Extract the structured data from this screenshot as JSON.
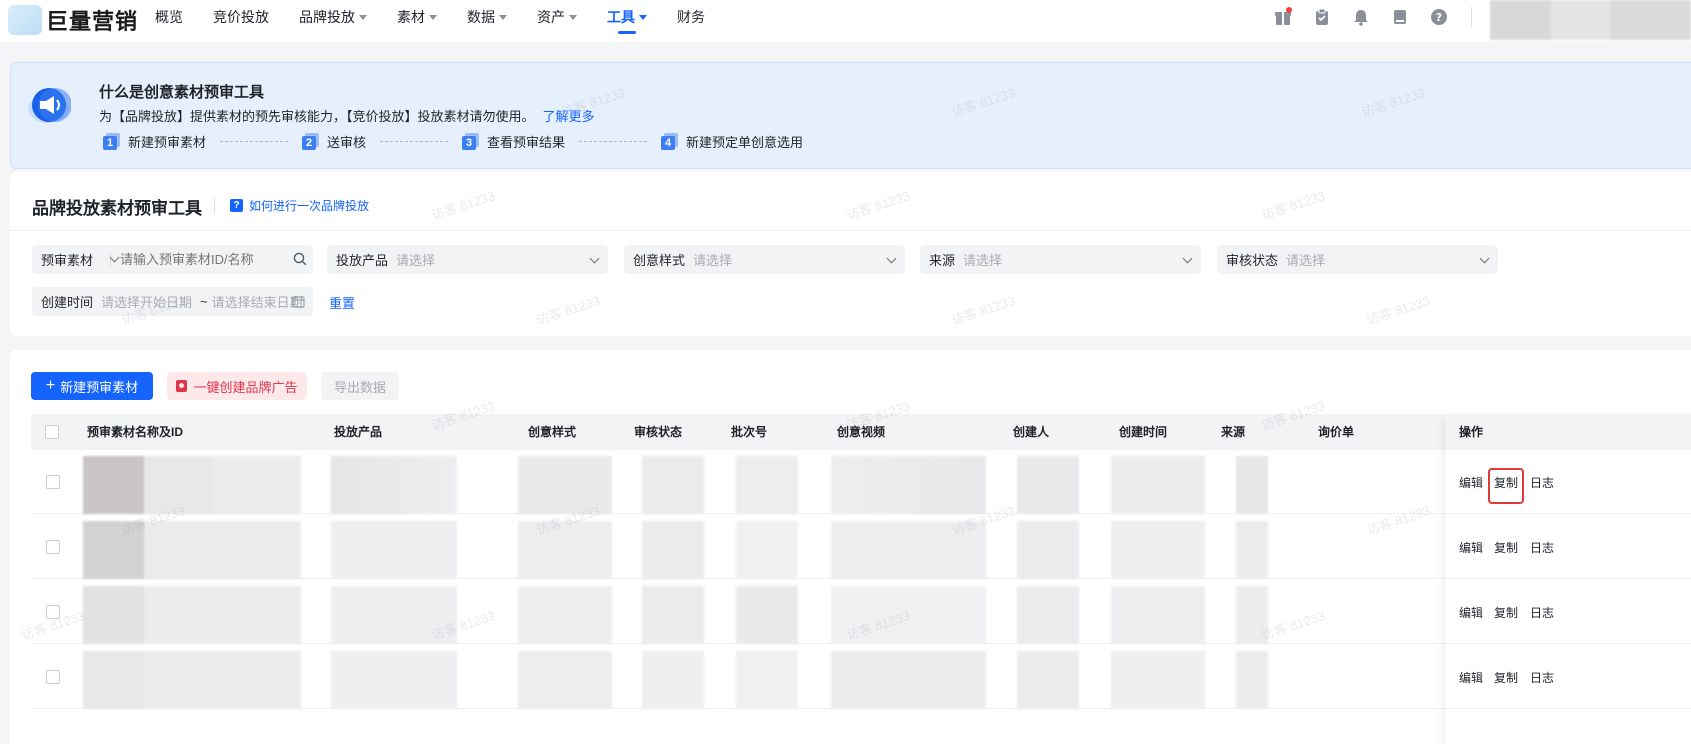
{
  "brand": {
    "name": "巨量营销"
  },
  "nav": {
    "items": [
      {
        "label": "概览",
        "dropdown": false,
        "active": false
      },
      {
        "label": "竞价投放",
        "dropdown": false,
        "active": false
      },
      {
        "label": "品牌投放",
        "dropdown": true,
        "active": false
      },
      {
        "label": "素材",
        "dropdown": true,
        "active": false
      },
      {
        "label": "数据",
        "dropdown": true,
        "active": false
      },
      {
        "label": "资产",
        "dropdown": true,
        "active": false
      },
      {
        "label": "工具",
        "dropdown": true,
        "active": true
      },
      {
        "label": "财务",
        "dropdown": false,
        "active": false
      }
    ],
    "icons": [
      "gift-icon",
      "clipboard-icon",
      "bell-icon",
      "document-icon",
      "help-icon"
    ],
    "accent": "#1664ff"
  },
  "banner": {
    "title": "什么是创意素材预审工具",
    "desc": "为【品牌投放】提供素材的预先审核能力，【竞价投放】投放素材请勿使用。",
    "link": "了解更多",
    "steps": [
      {
        "num": "1",
        "label": "新建预审素材"
      },
      {
        "num": "2",
        "label": "送审核"
      },
      {
        "num": "3",
        "label": "查看预审结果"
      },
      {
        "num": "4",
        "label": "新建预定单创意选用"
      }
    ]
  },
  "tool": {
    "title": "品牌投放素材预审工具",
    "help_link": "如何进行一次品牌投放",
    "filters": {
      "material_type": "预审素材",
      "search_placeholder": "请输入预审素材ID/名称",
      "product_label": "投放产品",
      "product_placeholder": "请选择",
      "style_label": "创意样式",
      "style_placeholder": "请选择",
      "source_label": "来源",
      "source_placeholder": "请选择",
      "status_label": "审核状态",
      "status_placeholder": "请选择",
      "created_label": "创建时间",
      "start_placeholder": "请选择开始日期",
      "range_sep": "~",
      "end_placeholder": "请选择结束日期",
      "reset": "重置"
    }
  },
  "actions": {
    "new_material": "新建预审素材",
    "create_brand_ad": "一键创建品牌广告",
    "export": "导出数据"
  },
  "table": {
    "columns": [
      "预审素材名称及ID",
      "投放产品",
      "创意样式",
      "审核状态",
      "批次号",
      "创意视频",
      "创建人",
      "创建时间",
      "来源",
      "询价单",
      "操作"
    ],
    "row_ops": [
      "编辑",
      "复制",
      "日志"
    ]
  },
  "watermark": "访客 81233"
}
